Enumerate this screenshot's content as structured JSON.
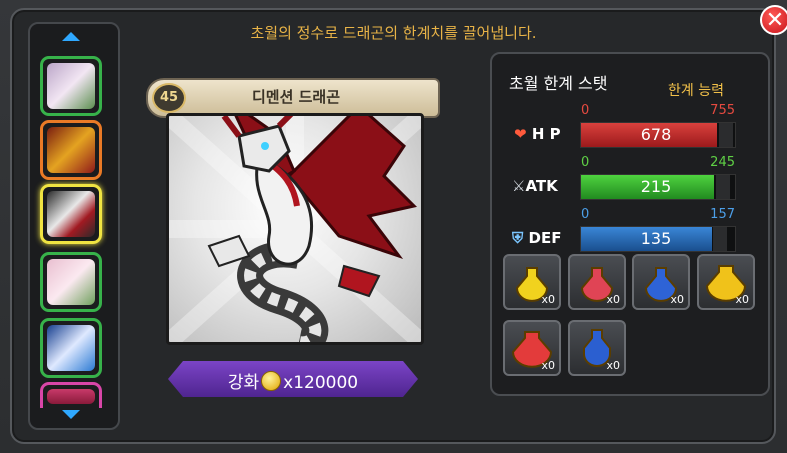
{
  "header": {
    "message": "초월의 정수로 드래곤의 한계치를 끌어냅니다.",
    "close_icon": "close-icon"
  },
  "dragon_list": {
    "scroll_up_icon": "chevron-up-icon",
    "scroll_down_icon": "chevron-down-icon",
    "slots": [
      {
        "border": "#37b24a",
        "selected": false
      },
      {
        "border": "#ea7a26",
        "selected": false
      },
      {
        "border": "#f0e442",
        "selected": true
      },
      {
        "border": "#37b24a",
        "selected": false
      },
      {
        "border": "#37b24a",
        "selected": false
      },
      {
        "border": "#d946a8",
        "selected": false
      }
    ]
  },
  "dragon": {
    "level": "45",
    "name": "디멘션 드래곤"
  },
  "enhance": {
    "label": "강화",
    "cost": "x120000",
    "coin_icon": "gold-coin-icon"
  },
  "stats_panel": {
    "title": "초월 한계 스탯",
    "subtitle": "한계 능력",
    "stats": [
      {
        "label": "H P",
        "icon": "heart-icon",
        "min": "0",
        "max": "755",
        "value": "678",
        "fill": 0.898,
        "color": "#c0282a",
        "range_color": "#e64a40"
      },
      {
        "label": "ATK",
        "icon": "crossed-swords-icon",
        "min": "0",
        "max": "245",
        "value": "215",
        "fill": 0.878,
        "color": "#3ab230",
        "range_color": "#5fd045"
      },
      {
        "label": "DEF",
        "icon": "shield-icon",
        "min": "0",
        "max": "157",
        "value": "135",
        "fill": 0.86,
        "color": "#2a6ab8",
        "range_color": "#4c9fe8"
      }
    ]
  },
  "potions": [
    {
      "qty": "x0",
      "color": "#f1d21e"
    },
    {
      "qty": "x0",
      "color": "#e04455"
    },
    {
      "qty": "x0",
      "color": "#2e63d6"
    },
    {
      "qty": "x0",
      "color": "#f0c21a"
    },
    {
      "qty": "x0",
      "color": "#e33b3b"
    },
    {
      "qty": "x0",
      "color": "#2b5fd0"
    }
  ]
}
